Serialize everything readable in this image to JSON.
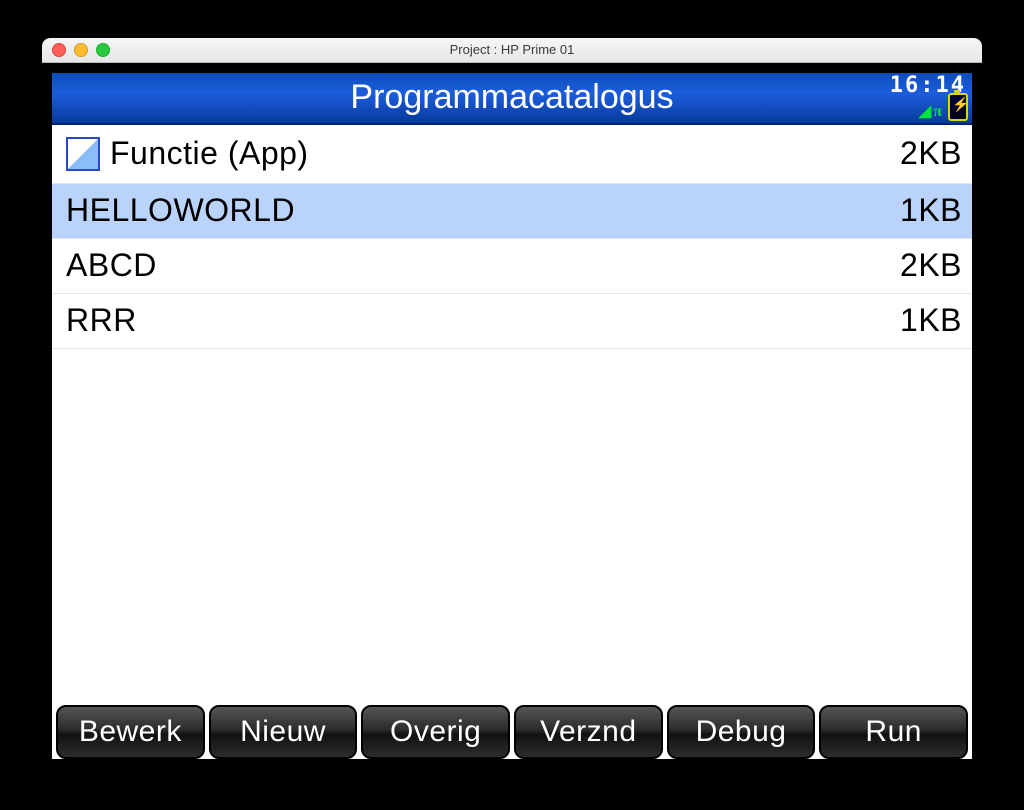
{
  "window": {
    "title": "Project : HP Prime 01"
  },
  "header": {
    "title": "Programmacatalogus",
    "time": "16:14"
  },
  "programs": [
    {
      "name": "Functie (App)",
      "size": "2KB",
      "icon": true,
      "selected": false
    },
    {
      "name": "HELLOWORLD",
      "size": "1KB",
      "icon": false,
      "selected": true
    },
    {
      "name": "ABCD",
      "size": "2KB",
      "icon": false,
      "selected": false
    },
    {
      "name": "RRR",
      "size": "1KB",
      "icon": false,
      "selected": false
    }
  ],
  "softkeys": [
    "Bewerk",
    "Nieuw",
    "Overig",
    "Verznd",
    "Debug",
    "Run"
  ]
}
